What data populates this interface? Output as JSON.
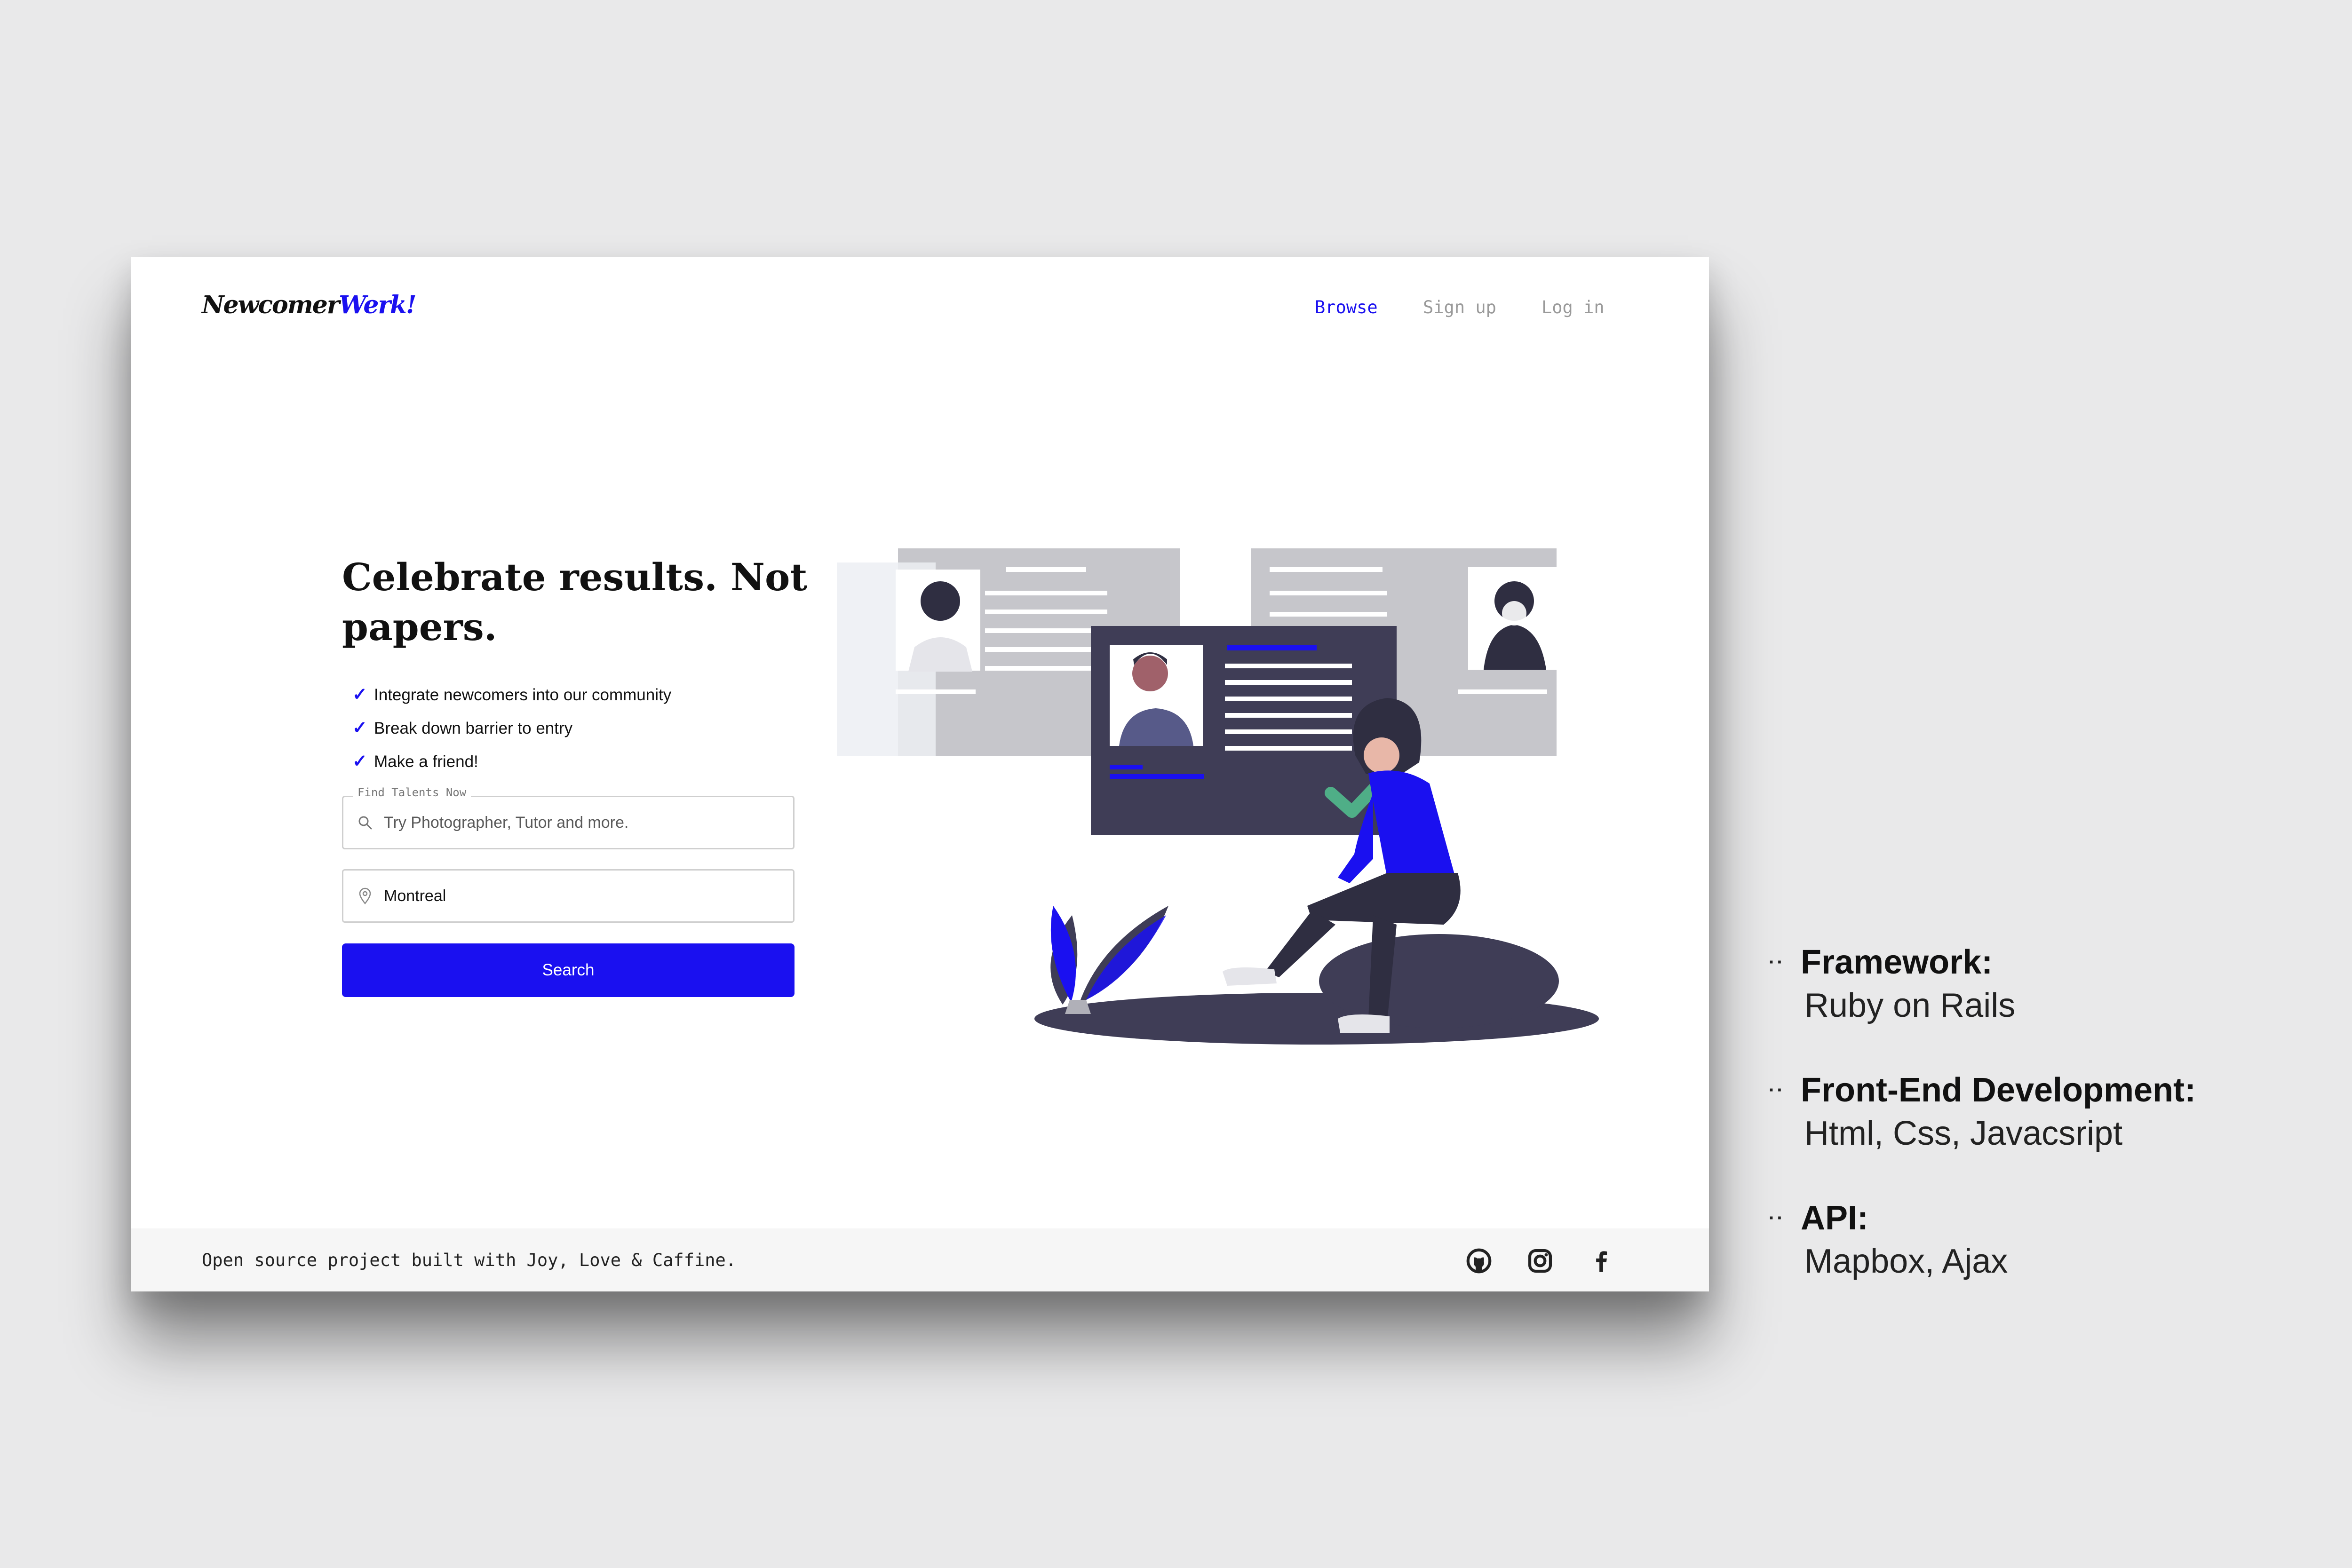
{
  "header": {
    "logo_part1": "Newcomer",
    "logo_part2": "Werk!",
    "nav": [
      {
        "label": "Browse"
      },
      {
        "label": "Sign up"
      },
      {
        "label": "Log in"
      }
    ]
  },
  "hero": {
    "title": "Celebrate results. Not papers.",
    "features": [
      "Integrate newcomers into our community",
      "Break down barrier to entry",
      "Make a friend!"
    ],
    "check_glyph": "✓",
    "talent_legend": "Find Talents Now",
    "talent_placeholder": "Try Photographer, Tutor and more.",
    "location_value": "Montreal",
    "search_label": "Search"
  },
  "footer": {
    "text": "Open source project built with Joy, Love & Caffine.",
    "social_icons": [
      "github-icon",
      "instagram-icon",
      "facebook-icon"
    ]
  },
  "notes": [
    {
      "label": "Framework:",
      "value": "Ruby on Rails"
    },
    {
      "label": "Front-End Development:",
      "value": "Html, Css, Javacsript"
    },
    {
      "label": "API:",
      "value": "Mapbox, Ajax"
    }
  ],
  "colors": {
    "accent": "#1a10f0",
    "background": "#e9e9ea",
    "card_grey": "#c6c6cb",
    "card_dark": "#3f3d56",
    "check_green": "#4fae87"
  }
}
